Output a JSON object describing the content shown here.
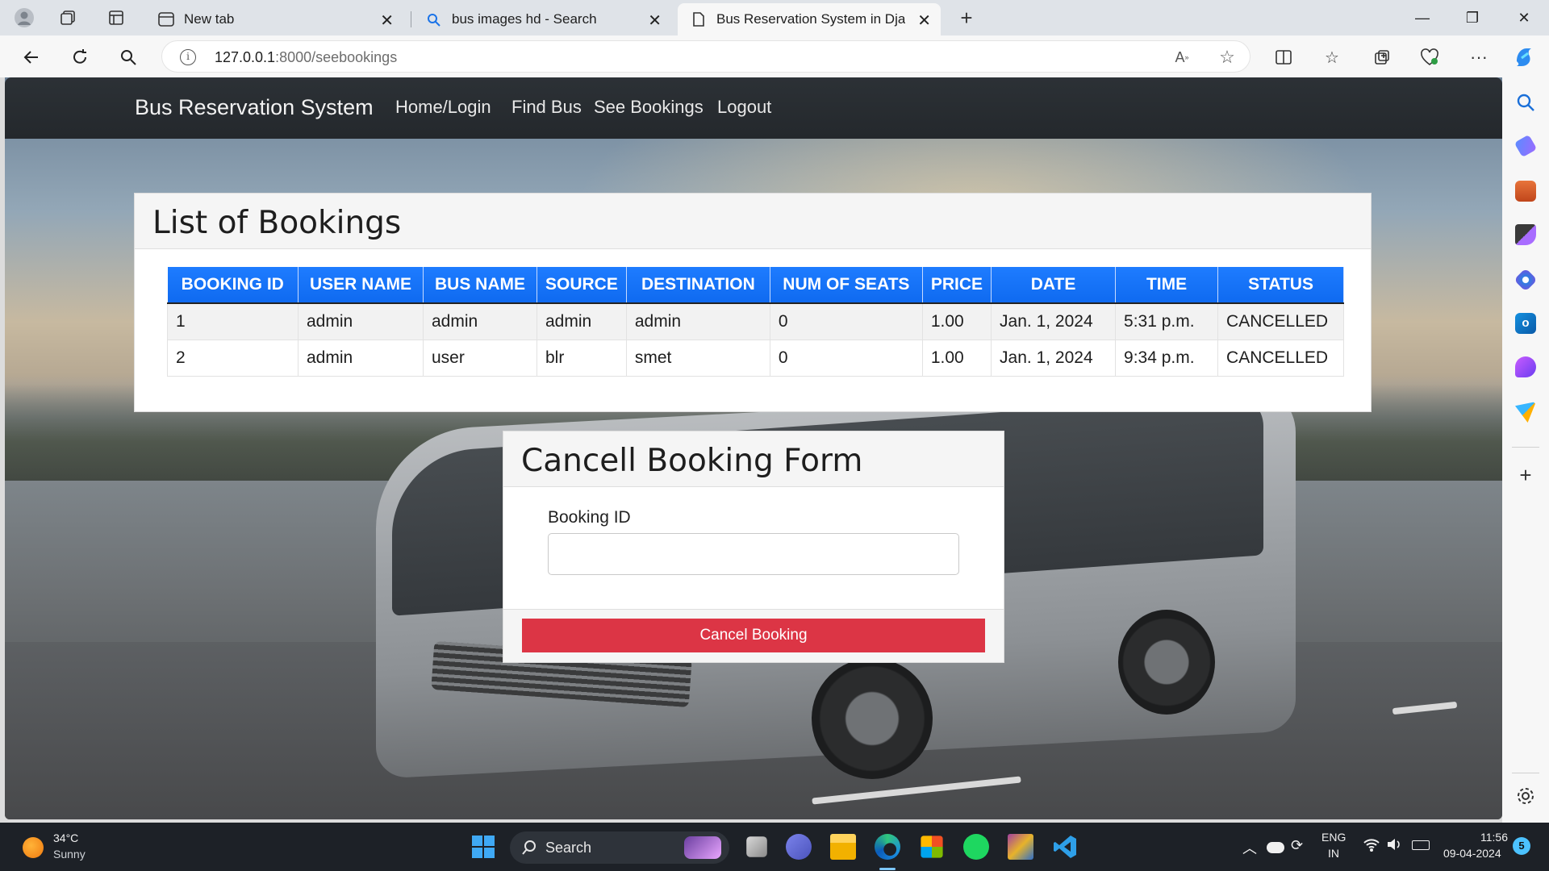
{
  "browser": {
    "tabs": [
      {
        "title": "New tab",
        "active": false
      },
      {
        "title": "bus images hd - Search",
        "active": false
      },
      {
        "title": "Bus Reservation System in Django",
        "active": true
      }
    ],
    "address": {
      "host": "127.0.0.1",
      "path": ":8000/seebookings"
    }
  },
  "site": {
    "brand": "Bus Reservation System",
    "nav": [
      "Home/Login",
      "Find Bus",
      "See Bookings",
      "Logout"
    ]
  },
  "bookings": {
    "title": "List of Bookings",
    "columns": [
      "BOOKING ID",
      "USER NAME",
      "BUS NAME",
      "SOURCE",
      "DESTINATION",
      "NUM OF SEATS",
      "PRICE",
      "DATE",
      "TIME",
      "STATUS"
    ],
    "rows": [
      [
        "1",
        "admin",
        "admin",
        "admin",
        "admin",
        "0",
        "1.00",
        "Jan. 1, 2024",
        "5:31 p.m.",
        "CANCELLED"
      ],
      [
        "2",
        "admin",
        "user",
        "blr",
        "smet",
        "0",
        "1.00",
        "Jan. 1, 2024",
        "9:34 p.m.",
        "CANCELLED"
      ]
    ]
  },
  "cancel_form": {
    "title": "Cancell Booking Form",
    "field_label": "Booking ID",
    "field_value": "",
    "button_label": "Cancel Booking",
    "button_color": "#dc3545"
  },
  "taskbar": {
    "weather_temp": "34°C",
    "weather_desc": "Sunny",
    "search_label": "Search",
    "lang_top": "ENG",
    "lang_bottom": "IN",
    "time": "11:56",
    "date": "09-04-2024",
    "notification_count": "5"
  },
  "colors": {
    "table_header": "#0f6af0",
    "navbar": "#24282c",
    "danger": "#dc3545"
  }
}
